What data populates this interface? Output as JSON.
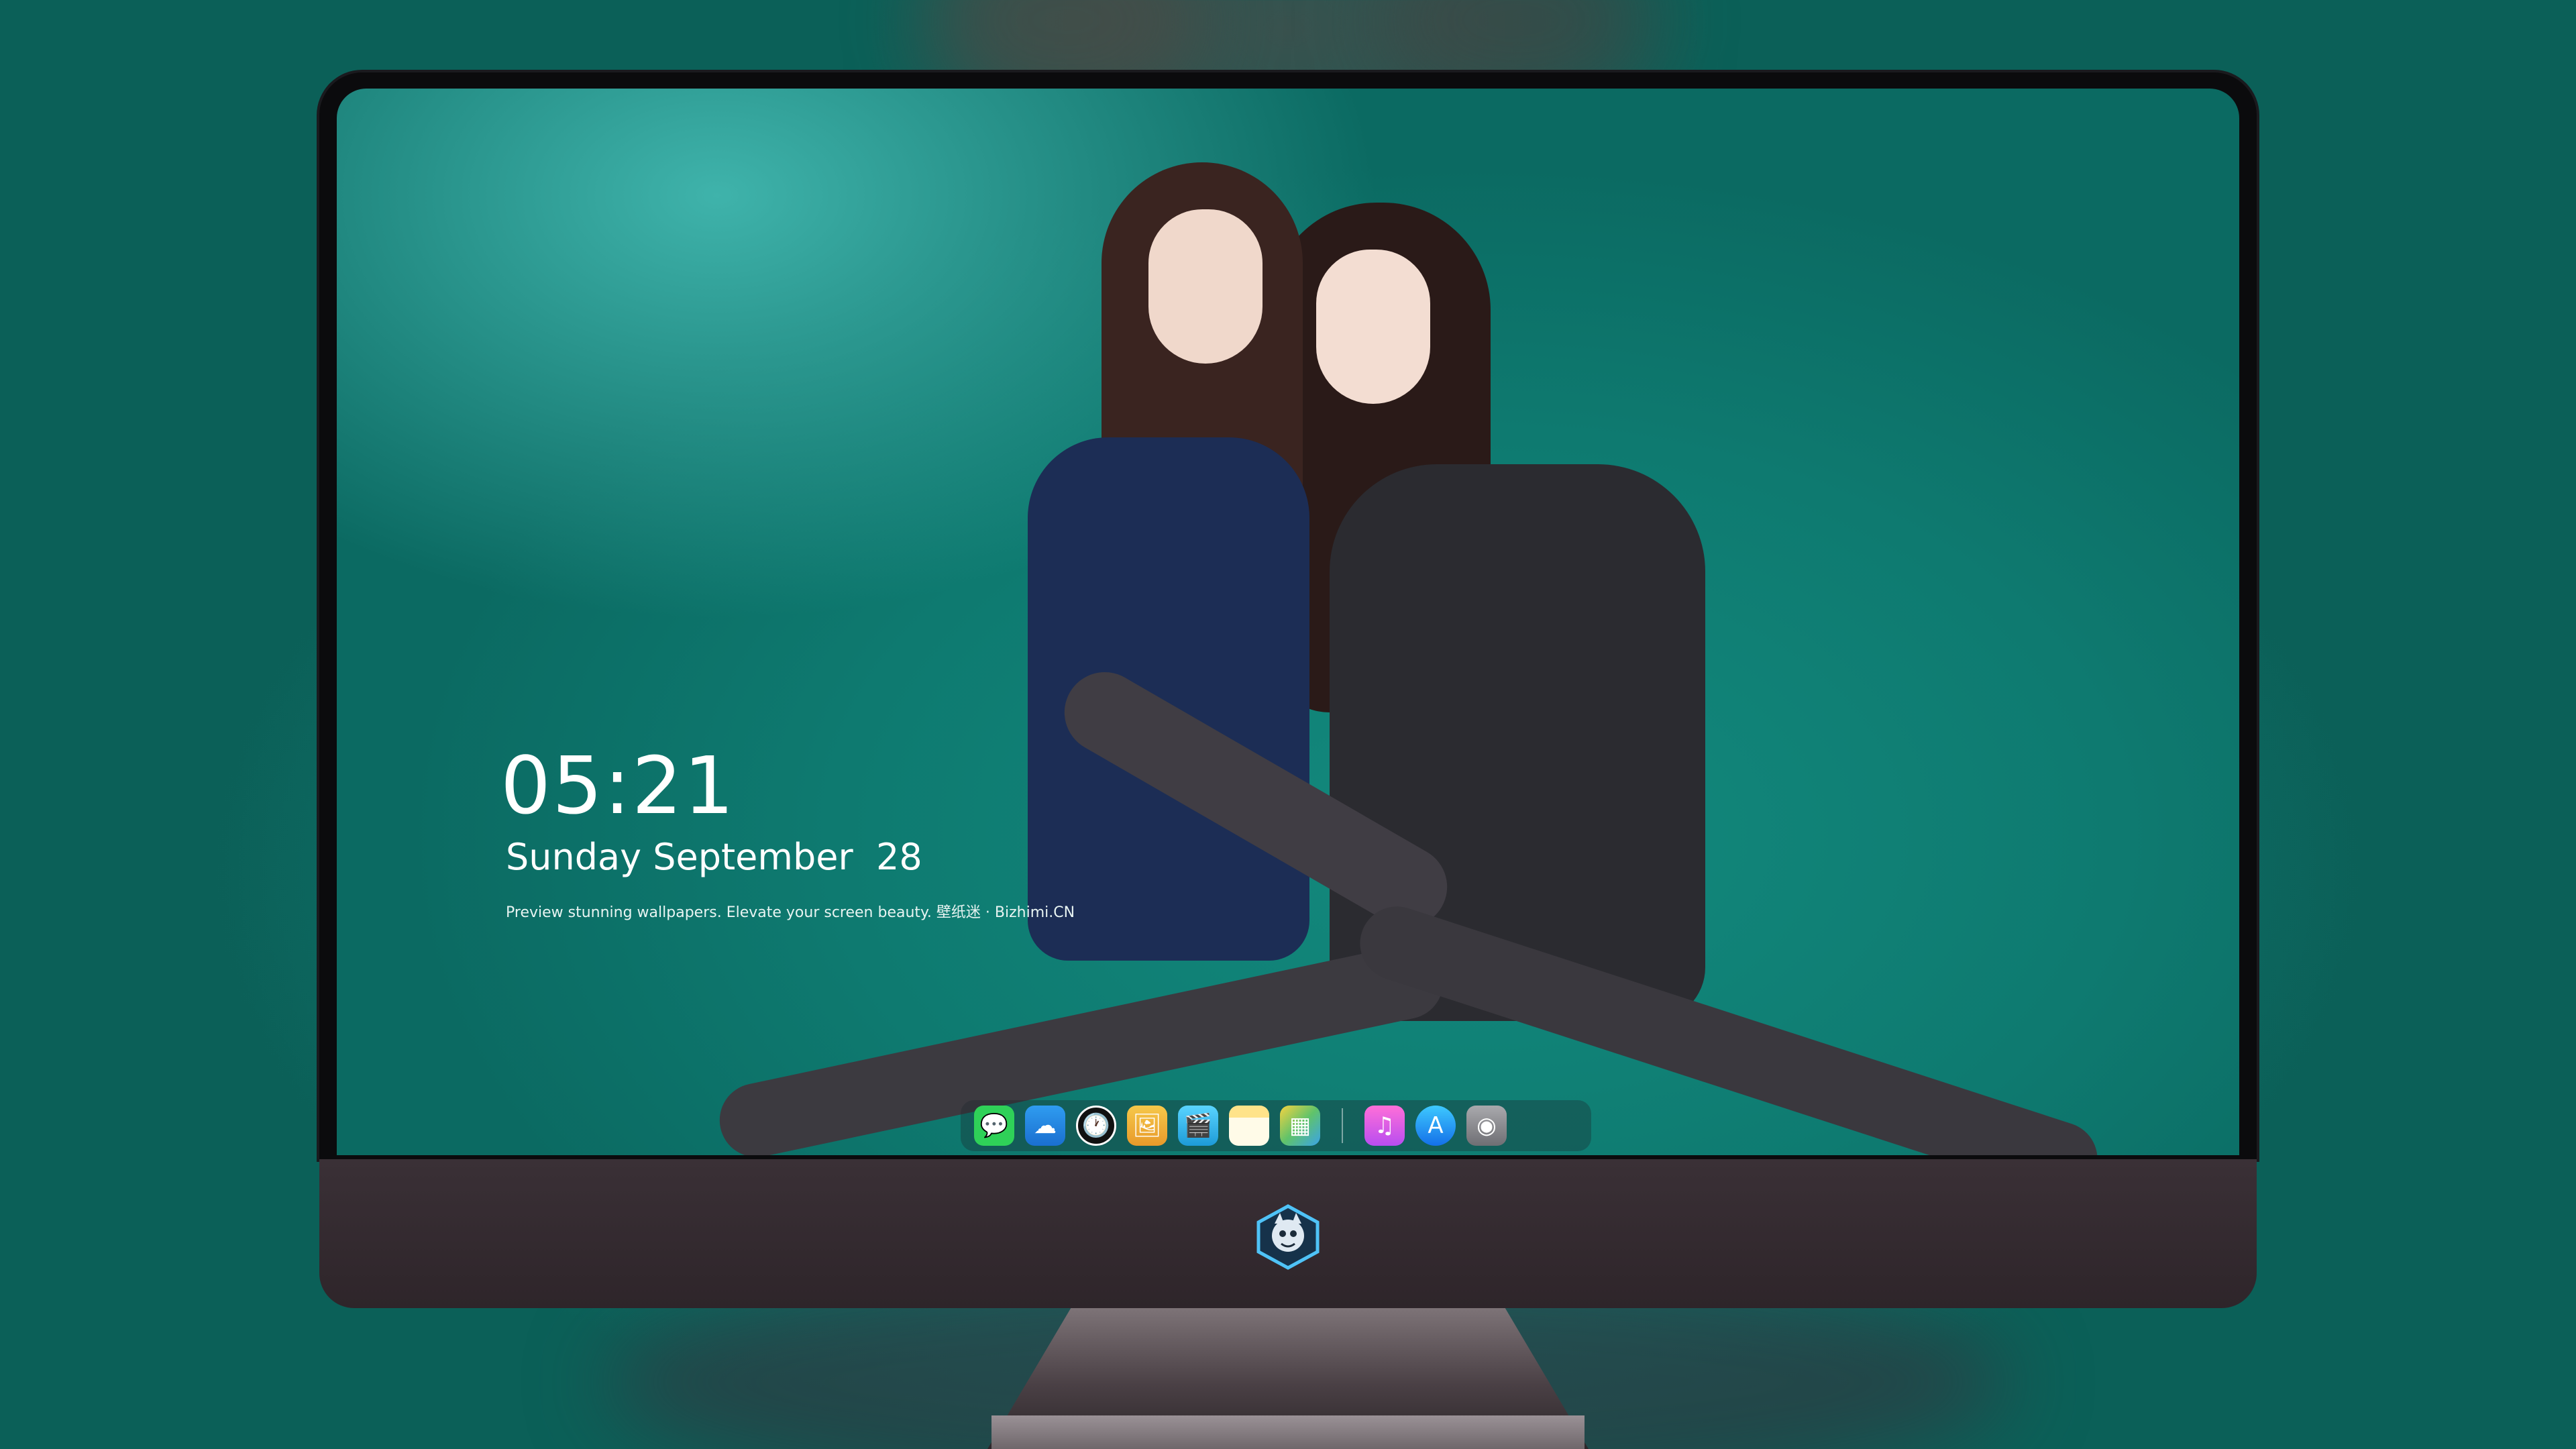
{
  "lockscreen": {
    "time": "05:21",
    "date": "Sunday September  28",
    "tagline": "Preview stunning wallpapers. Elevate your screen beauty. 壁纸迷 · Bizhimi.CN"
  },
  "dock": {
    "icons": [
      {
        "name": "messages-icon",
        "glyph": "💬"
      },
      {
        "name": "weather-icon",
        "glyph": "☁"
      },
      {
        "name": "clock-icon",
        "glyph": "🕐"
      },
      {
        "name": "preview-icon",
        "glyph": "🖼"
      },
      {
        "name": "video-icon",
        "glyph": "🎬"
      },
      {
        "name": "notes-icon",
        "glyph": ""
      },
      {
        "name": "photos-icon",
        "glyph": "▦"
      },
      {
        "name": "music-icon",
        "glyph": "♫"
      },
      {
        "name": "app-store-icon",
        "glyph": "A"
      },
      {
        "name": "camera-icon",
        "glyph": "◉"
      }
    ]
  },
  "colors": {
    "wallpaper": "#138a7e",
    "bezel": "#0b0b0d",
    "chin": "#3a3036"
  }
}
